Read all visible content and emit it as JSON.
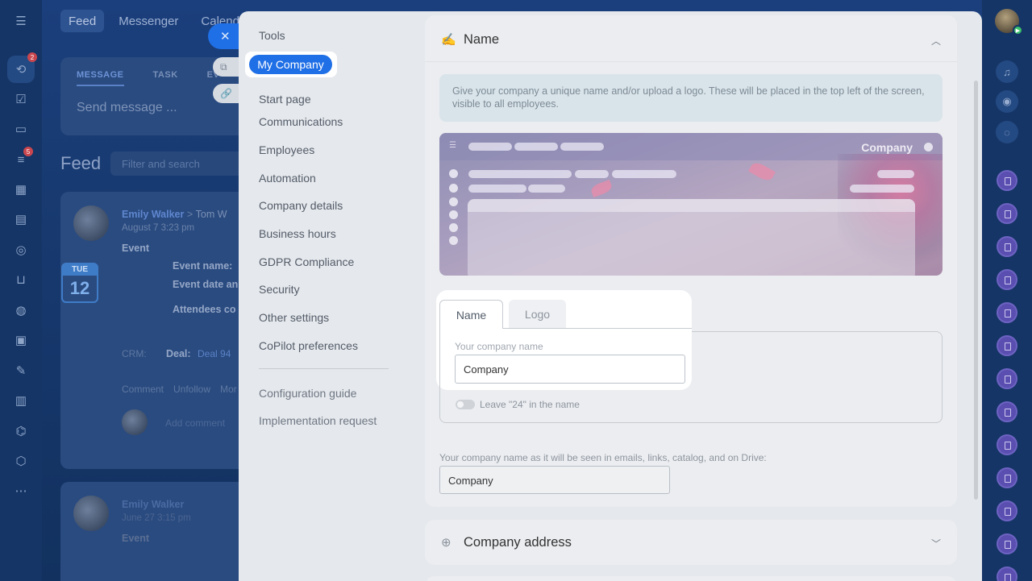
{
  "background": {
    "top_tabs": [
      "Feed",
      "Messenger",
      "Calendar"
    ],
    "composer": {
      "tabs": [
        "MESSAGE",
        "TASK",
        "EV"
      ],
      "placeholder": "Send message ..."
    },
    "feed_title": "Feed",
    "feed_filter_placeholder": "Filter and search",
    "post1": {
      "author": "Emily Walker",
      "arrow": ">",
      "recipient": "Tom W",
      "date": "August 7 3:23 pm",
      "type": "Event",
      "cal_month": "TUE",
      "cal_day": "12",
      "event_name_label": "Event name:",
      "event_date_label": "Event date an",
      "attendees_label": "Attendees co",
      "crm_label": "CRM:",
      "deal_label": "Deal:",
      "deal_value": "Deal 94",
      "actions": [
        "Comment",
        "Unfollow",
        "Mor"
      ],
      "add_comment": "Add comment"
    },
    "post2": {
      "author": "Emily Walker",
      "date": "June 27 3:15 pm",
      "type": "Event"
    },
    "rail_badges": [
      "2",
      "5"
    ]
  },
  "slider": {
    "nav": {
      "items": [
        "Tools",
        "My Company",
        "Start page",
        "Communications",
        "Employees",
        "Automation",
        "Company details",
        "Business hours",
        "GDPR Compliance",
        "Security",
        "Other settings",
        "CoPilot preferences"
      ],
      "secondary": [
        "Configuration guide",
        "Implementation request"
      ],
      "active": "My Company"
    },
    "name_card": {
      "title": "Name",
      "hint": "Give your company a unique name and/or upload a logo. These will be placed in the top left of the screen, visible to all employees.",
      "preview_company": "Company",
      "tabs": [
        "Name",
        "Logo"
      ],
      "field_label": "Your company name",
      "field_value": "Company",
      "toggle_label": "Leave \"24\" in the name",
      "drive_label": "Your company name as it will be seen in emails, links, catalog, and on Drive:",
      "drive_value": "Company"
    },
    "address_card": {
      "title": "Company address"
    }
  },
  "colors": {
    "accent": "#1f6fe6",
    "panel": "#e5e8ec",
    "hint_bg": "#d9e4ea"
  }
}
